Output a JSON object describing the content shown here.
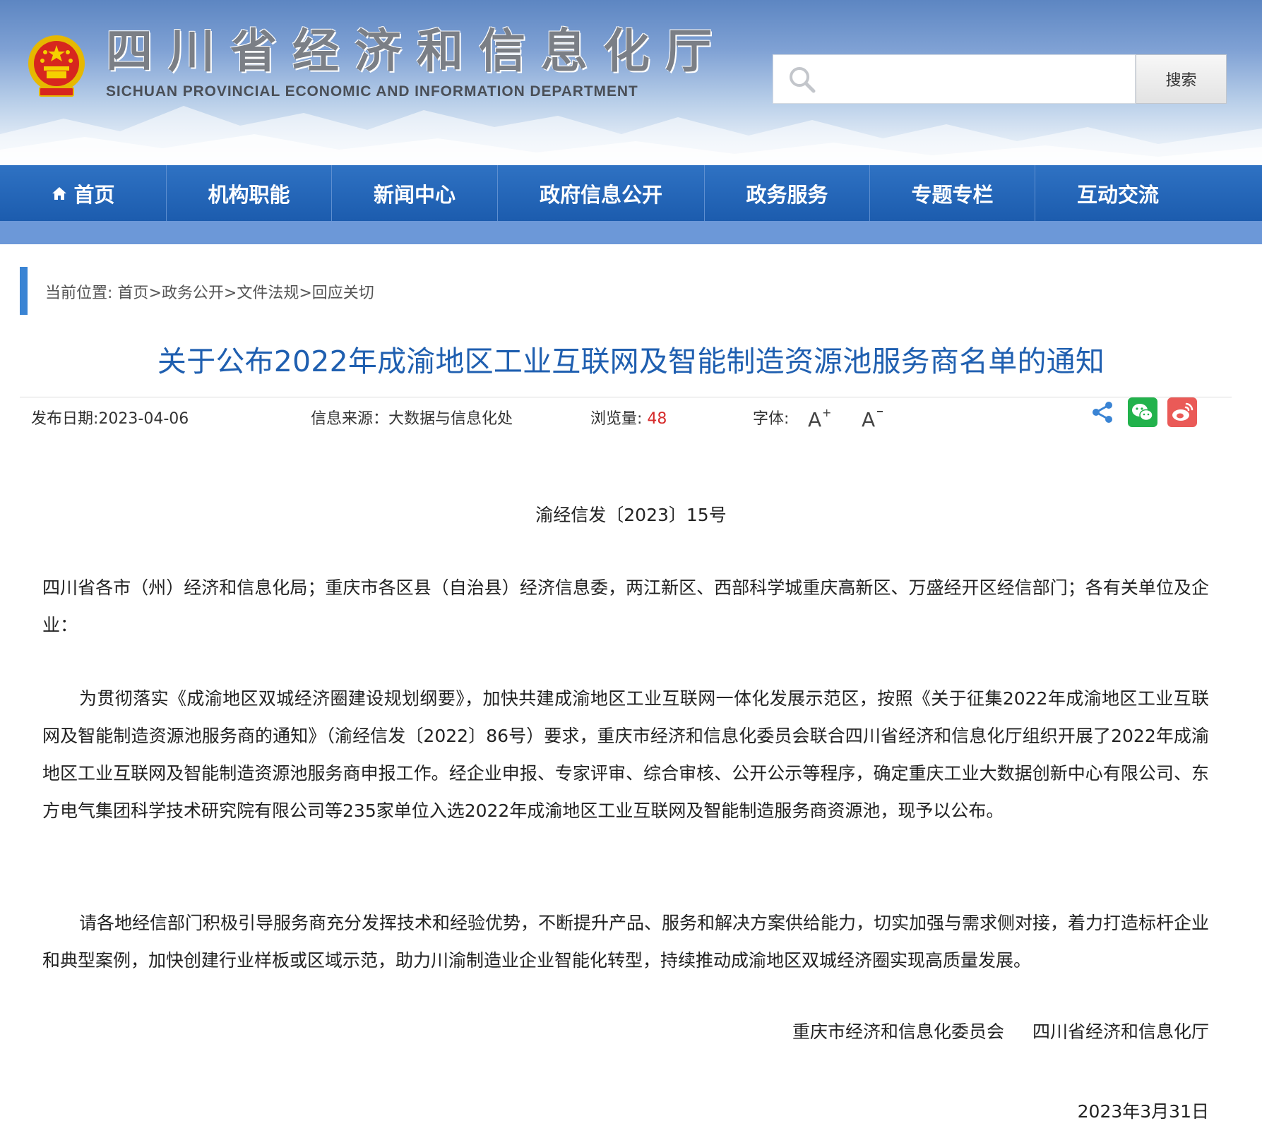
{
  "header": {
    "site_title": "四川省经济和信息化厅",
    "site_subtitle": "SICHUAN PROVINCIAL ECONOMIC AND INFORMATION DEPARTMENT",
    "emblem_icon": "national-emblem-icon",
    "search": {
      "placeholder": "",
      "button_label": "搜索",
      "icon": "search-icon"
    }
  },
  "nav": {
    "items": [
      {
        "label": "首页",
        "icon": "home-icon"
      },
      {
        "label": "机构职能"
      },
      {
        "label": "新闻中心"
      },
      {
        "label": "政府信息公开"
      },
      {
        "label": "政务服务"
      },
      {
        "label": "专题专栏"
      },
      {
        "label": "互动交流"
      }
    ],
    "color": "#1f62b5"
  },
  "breadcrumb": {
    "prefix": "当前位置:",
    "items": [
      "首页",
      "政务公开",
      "文件法规",
      "回应关切"
    ],
    "separator": ">"
  },
  "article": {
    "title": "关于公布2022年成渝地区工业互联网及智能制造资源池服务商名单的通知",
    "title_color": "#1f5fb0",
    "meta": {
      "publish_date_label": "发布日期:",
      "publish_date": "2023-04-06",
      "source_label": "信息来源：",
      "source": "大数据与信息化处",
      "views_label": "浏览量:",
      "views": "48",
      "font_label": "字体:",
      "font_increase": "A+",
      "font_decrease": "A-"
    },
    "share_icons": [
      "share-icon",
      "wechat-icon",
      "weibo-icon"
    ],
    "doc_number": "渝经信发〔2023〕15号",
    "paragraphs": [
      "四川省各市（州）经济和信息化局；重庆市各区县（自治县）经济信息委，两江新区、西部科学城重庆高新区、万盛经开区经信部门；各有关单位及企业：",
      "为贯彻落实《成渝地区双城经济圈建设规划纲要》，加快共建成渝地区工业互联网一体化发展示范区，按照《关于征集2022年成渝地区工业互联网及智能制造资源池服务商的通知》（渝经信发〔2022〕86号）要求，重庆市经济和信息化委员会联合四川省经济和信息化厅组织开展了2022年成渝地区工业互联网及智能制造资源池服务商申报工作。经企业申报、专家评审、综合审核、公开公示等程序，确定重庆工业大数据创新中心有限公司、东方电气集团科学技术研究院有限公司等235家单位入选2022年成渝地区工业互联网及智能制造服务商资源池，现予以公布。",
      "请各地经信部门积极引导服务商充分发挥技术和经验优势，不断提升产品、服务和解决方案供给能力，切实加强与需求侧对接，着力打造标杆企业和典型案例，加快创建行业样板或区域示范，助力川渝制造业企业智能化转型，持续推动成渝地区双城经济圈实现高质量发展。"
    ],
    "signers": [
      "重庆市经济和信息化委员会",
      "四川省经济和信息化厅"
    ],
    "sign_date": "2023年3月31日"
  }
}
